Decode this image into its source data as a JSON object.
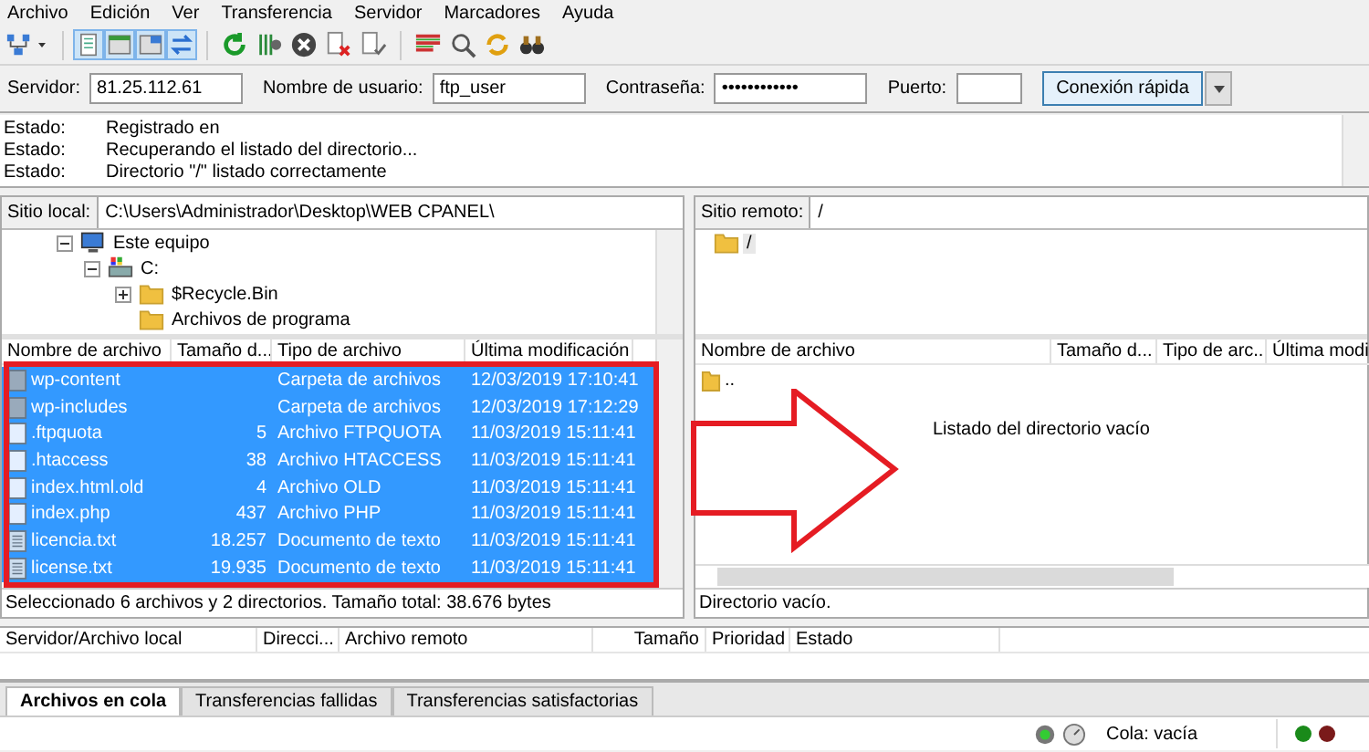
{
  "menu": [
    "Archivo",
    "Edición",
    "Ver",
    "Transferencia",
    "Servidor",
    "Marcadores",
    "Ayuda"
  ],
  "quickconnect": {
    "fields": [
      {
        "label": "Servidor:",
        "value": "81.25.112.61",
        "kind": "wide"
      },
      {
        "label": "Nombre de usuario:",
        "value": "ftp_user",
        "kind": "wide"
      },
      {
        "label": "Contraseña:",
        "value": "••••••••••••",
        "kind": "wide"
      },
      {
        "label": "Puerto:",
        "kind": "narrow"
      }
    ],
    "button": "Conexión rápida"
  },
  "log": [
    {
      "label": "Estado:",
      "text": "Registrado en"
    },
    {
      "label": "Estado:",
      "text": "Recuperando el listado del directorio..."
    },
    {
      "label": "Estado:",
      "text": "Directorio \"/\" listado correctamente"
    }
  ],
  "local": {
    "site_label": "Sitio local:",
    "path": "C:\\Users\\Administrador\\Desktop\\WEB CPANEL\\",
    "tree": [
      {
        "name": "Este equipo",
        "kind": "computer",
        "expanded": true,
        "children": [
          {
            "name": "C:",
            "kind": "drive",
            "expanded": true,
            "children": [
              {
                "name": "$Recycle.Bin",
                "kind": "folder",
                "expanded": false
              },
              {
                "name": "Archivos de programa",
                "kind": "folder"
              }
            ]
          }
        ]
      }
    ],
    "columns": [
      "Nombre de archivo",
      "Tamaño d...",
      "Tipo de archivo",
      "Última modificación"
    ],
    "rows": [
      {
        "name": "wp-content",
        "size": "",
        "type": "Carpeta de archivos",
        "modified": "12/03/2019 17:10:41",
        "kind": "folder",
        "selected": true
      },
      {
        "name": "wp-includes",
        "size": "",
        "type": "Carpeta de archivos",
        "modified": "12/03/2019 17:12:29",
        "kind": "folder",
        "selected": true
      },
      {
        "name": ".ftpquota",
        "size": "5",
        "type": "Archivo FTPQUOTA",
        "modified": "11/03/2019 15:11:41",
        "kind": "file",
        "selected": true
      },
      {
        "name": ".htaccess",
        "size": "38",
        "type": "Archivo HTACCESS",
        "modified": "11/03/2019 15:11:41",
        "kind": "file",
        "selected": true
      },
      {
        "name": "index.html.old",
        "size": "4",
        "type": "Archivo OLD",
        "modified": "11/03/2019 15:11:41",
        "kind": "file",
        "selected": true
      },
      {
        "name": "index.php",
        "size": "437",
        "type": "Archivo PHP",
        "modified": "11/03/2019 15:11:41",
        "kind": "file",
        "selected": true
      },
      {
        "name": "licencia.txt",
        "size": "18.257",
        "type": "Documento de texto",
        "modified": "11/03/2019 15:11:41",
        "kind": "text",
        "selected": true
      },
      {
        "name": "license.txt",
        "size": "19.935",
        "type": "Documento de texto",
        "modified": "11/03/2019 15:11:41",
        "kind": "text",
        "selected": true
      }
    ],
    "status": "Seleccionado 6 archivos y 2 directorios. Tamaño total: 38.676 bytes"
  },
  "remote": {
    "site_label": "Sitio remoto:",
    "path": "/",
    "tree": [
      {
        "name": "/",
        "kind": "folder"
      }
    ],
    "columns": [
      "Nombre de archivo",
      "Tamaño d...",
      "Tipo de arc...",
      "Última modi"
    ],
    "rows": [
      {
        "name": "..",
        "kind": "folder",
        "selected": false
      }
    ],
    "empty_message": "Listado del directorio vacío",
    "status": "Directorio vacío."
  },
  "queue": {
    "columns": [
      "Servidor/Archivo local",
      "Direcci...",
      "Archivo remoto",
      "Tamaño",
      "Prioridad",
      "Estado"
    ],
    "tabs": [
      {
        "label": "Archivos en cola",
        "selected": true
      },
      {
        "label": "Transferencias fallidas",
        "selected": false
      },
      {
        "label": "Transferencias satisfactorias",
        "selected": false
      }
    ]
  },
  "status_bar": {
    "queue": "Cola: vacía"
  }
}
